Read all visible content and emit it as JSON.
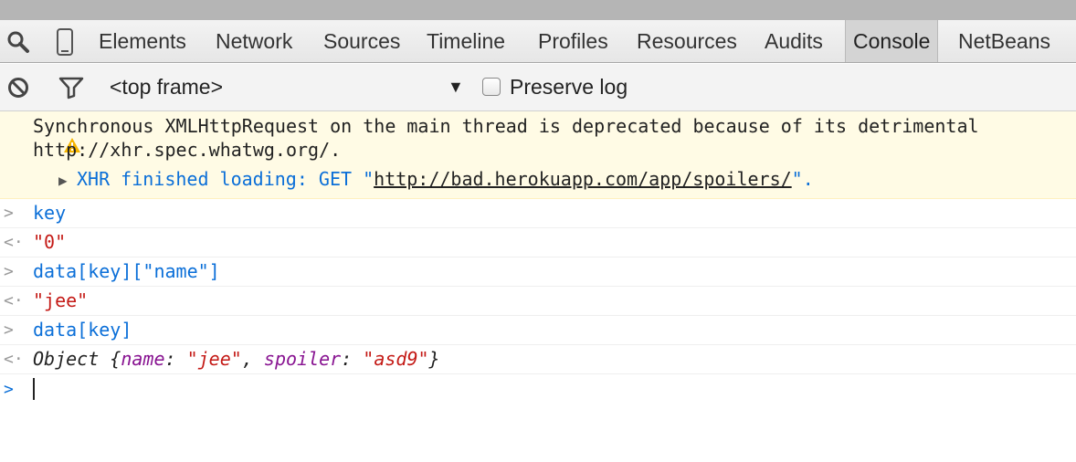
{
  "tabs": [
    {
      "label": "Elements",
      "active": false
    },
    {
      "label": "Network",
      "active": false
    },
    {
      "label": "Sources",
      "active": false
    },
    {
      "label": "Timeline",
      "active": false
    },
    {
      "label": "Profiles",
      "active": false
    },
    {
      "label": "Resources",
      "active": false
    },
    {
      "label": "Audits",
      "active": false
    },
    {
      "label": "Console",
      "active": true
    },
    {
      "label": "NetBeans",
      "active": false
    }
  ],
  "toolbar": {
    "frame_selector": "<top frame>",
    "preserve_log_label": "Preserve log",
    "preserve_log_checked": false
  },
  "console": {
    "warning_line1": "Synchronous XMLHttpRequest on the main thread is deprecated because of its detrimental",
    "warning_line2": "http://xhr.spec.whatwg.org/.",
    "xhr_prefix": "XHR finished loading: GET \"",
    "xhr_url": "http://bad.herokuapp.com/app/spoilers/",
    "xhr_suffix": "\".",
    "entries": [
      {
        "type": "input",
        "text": "key"
      },
      {
        "type": "output",
        "text": "\"0\""
      },
      {
        "type": "input",
        "text": "data[key][\"name\"]"
      },
      {
        "type": "output",
        "text": "\"jee\""
      },
      {
        "type": "input",
        "text": "data[key]"
      }
    ],
    "object_output": {
      "prefix": "Object {",
      "key1": "name",
      "val1": "\"jee\"",
      "key2": "spoiler",
      "val2": "\"asd9\"",
      "suffix": "}"
    }
  },
  "colors": {
    "accent": "#0b6fd8",
    "string": "#c41a16",
    "property": "#881391",
    "warning": "#f5b400"
  }
}
